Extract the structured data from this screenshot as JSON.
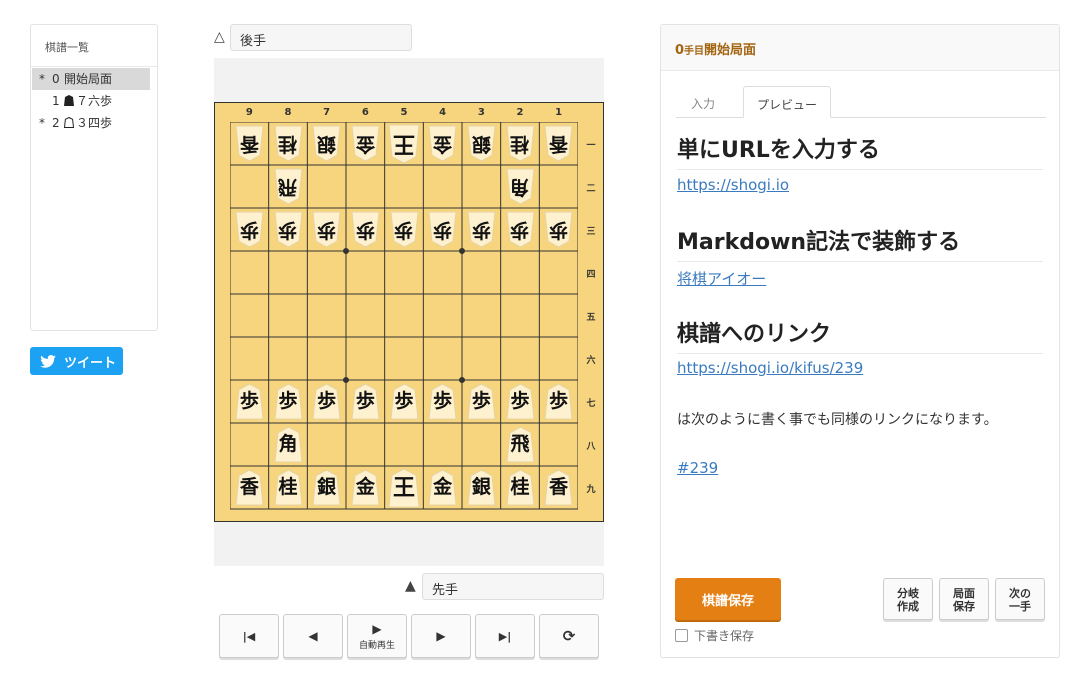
{
  "kifu_list": {
    "title": "棋譜一覧",
    "items": [
      {
        "mark": "*",
        "num": "0",
        "piece": "",
        "text": "開始局面"
      },
      {
        "mark": "",
        "num": "1",
        "piece": "black",
        "text": "７六歩"
      },
      {
        "mark": "*",
        "num": "2",
        "piece": "white",
        "text": "３四歩"
      }
    ]
  },
  "tweet": {
    "label": "ツイート",
    "icon": "twitter-bird-icon"
  },
  "players": {
    "gote": {
      "marker": "△",
      "name": "後手"
    },
    "sente": {
      "marker": "▲",
      "name": "先手"
    }
  },
  "board": {
    "files": [
      "9",
      "8",
      "7",
      "6",
      "5",
      "4",
      "3",
      "2",
      "1"
    ],
    "ranks": [
      "一",
      "二",
      "三",
      "四",
      "五",
      "六",
      "七",
      "八",
      "九"
    ],
    "pieces": [
      [
        "香g",
        "桂g",
        "銀g",
        "金g",
        "王g",
        "金g",
        "銀g",
        "桂g",
        "香g"
      ],
      [
        "",
        "飛g",
        "",
        "",
        "",
        "",
        "",
        "角g",
        ""
      ],
      [
        "歩g",
        "歩g",
        "歩g",
        "歩g",
        "歩g",
        "歩g",
        "歩g",
        "歩g",
        "歩g"
      ],
      [
        "",
        "",
        "",
        "",
        "",
        "",
        "",
        "",
        ""
      ],
      [
        "",
        "",
        "",
        "",
        "",
        "",
        "",
        "",
        ""
      ],
      [
        "",
        "",
        "",
        "",
        "",
        "",
        "",
        "",
        ""
      ],
      [
        "歩s",
        "歩s",
        "歩s",
        "歩s",
        "歩s",
        "歩s",
        "歩s",
        "歩s",
        "歩s"
      ],
      [
        "",
        "角s",
        "",
        "",
        "",
        "",
        "",
        "飛s",
        ""
      ],
      [
        "香s",
        "桂s",
        "銀s",
        "金s",
        "王s",
        "金s",
        "銀s",
        "桂s",
        "香s"
      ]
    ]
  },
  "controls": [
    {
      "name": "first-move-button",
      "glyph": "⏮",
      "label": ""
    },
    {
      "name": "prev-move-button",
      "glyph": "◀",
      "label": ""
    },
    {
      "name": "autoplay-button",
      "glyph": "▶",
      "label": "自動再生"
    },
    {
      "name": "next-move-button",
      "glyph": "▶",
      "label": ""
    },
    {
      "name": "last-move-button",
      "glyph": "⏭",
      "label": ""
    },
    {
      "name": "flip-board-button",
      "glyph": "⟳",
      "label": ""
    }
  ],
  "panel": {
    "header_num": "0",
    "header_unit": "手目",
    "header_text": "開始局面",
    "tabs": [
      "入力",
      "プレビュー"
    ],
    "active_tab": "プレビュー",
    "preview": {
      "h1": "単にURLを入力する",
      "link1": "https://shogi.io",
      "h2": "Markdown記法で装飾する",
      "link2": "将棋アイオー",
      "h3": "棋譜へのリンク",
      "link3": "https://shogi.io/kifus/239",
      "para": "は次のように書く事でも同様のリンクになります。",
      "link4": "#239"
    },
    "save_label": "棋譜保存",
    "draft_label": "下書き保存",
    "side_buttons": [
      {
        "name": "branch-create-button",
        "line1": "分岐",
        "line2": "作成"
      },
      {
        "name": "position-save-button",
        "line1": "局面",
        "line2": "保存"
      },
      {
        "name": "next-move-suggest-button",
        "line1": "次の",
        "line2": "一手"
      }
    ]
  },
  "colors": {
    "accent": "#e47f14",
    "board": "#f6d57e",
    "tweet": "#1da1f2",
    "link": "#3a7bbf"
  }
}
